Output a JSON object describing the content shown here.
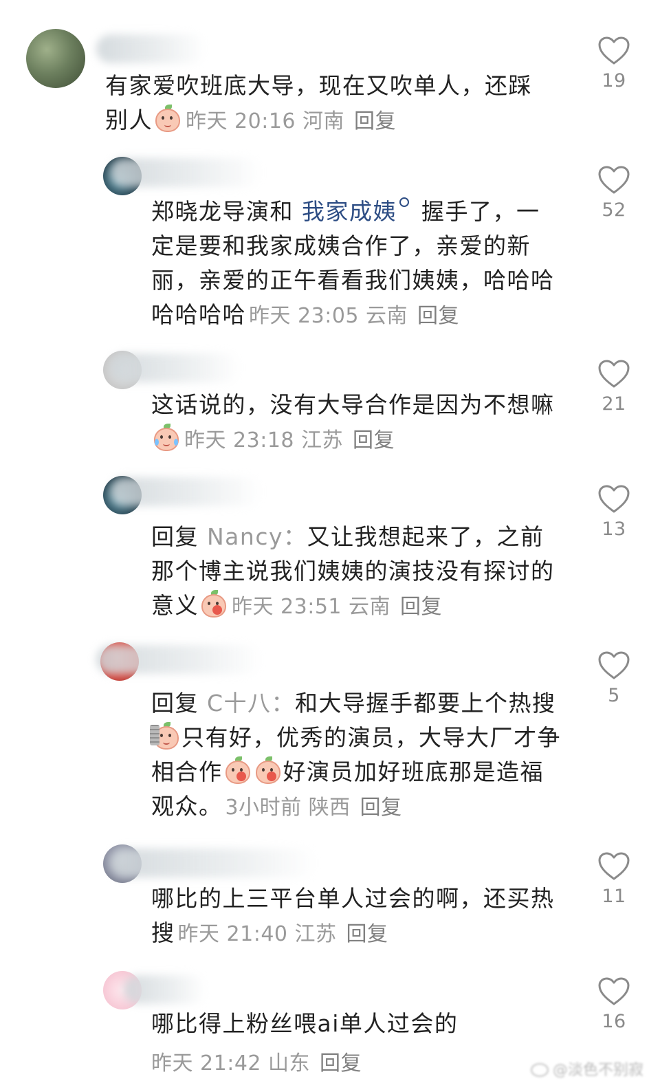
{
  "comments": [
    {
      "text": "有家爱吹班底大导，现在又吹单人，还踩别人",
      "time": "昨天 20:16",
      "location": "河南",
      "reply_label": "回复",
      "likes": "19"
    },
    {
      "text_before": "郑晓龙导演和 ",
      "link": "我家成姨",
      "text_after": " 握手了，一定是要和我家成姨合作了，亲爱的新丽，亲爱的正午看看我们姨姨，哈哈哈哈哈哈哈",
      "time": "昨天 23:05",
      "location": "云南",
      "reply_label": "回复",
      "likes": "52"
    },
    {
      "text": "这话说的，没有大导合作是因为不想嘛",
      "time": "昨天 23:18",
      "location": "江苏",
      "reply_label": "回复",
      "likes": "21"
    },
    {
      "prefix": "回复",
      "mention": "Nancy：",
      "text": "又让我想起来了，之前那个博主说我们姨姨的演技没有探讨的意义",
      "time": "昨天 23:51",
      "location": "云南",
      "reply_label": "回复",
      "likes": "13"
    },
    {
      "prefix": "回复",
      "mention": "C十八：",
      "text_1": "和大导握手都要上个热搜",
      "text_2": "只有好，优秀的演员，大导大厂才争相合作",
      "text_3": "好演员加好班底那是造福观众。",
      "time": "3小时前",
      "location": "陕西",
      "reply_label": "回复",
      "likes": "5"
    },
    {
      "text": "哪比的上三平台单人过会的啊，还买热搜",
      "time": "昨天 21:40",
      "location": "江苏",
      "reply_label": "回复",
      "likes": "11"
    },
    {
      "text": "哪比得上粉丝喂ai单人过会的",
      "time": "昨天 21:42",
      "location": "山东",
      "reply_label": "回复",
      "likes": "16"
    }
  ],
  "watermark": "@淡色不别寂",
  "colors": {
    "text": "#222222",
    "meta": "#9a9a9a",
    "link": "#2d4d84",
    "like": "#8a8a8a"
  }
}
